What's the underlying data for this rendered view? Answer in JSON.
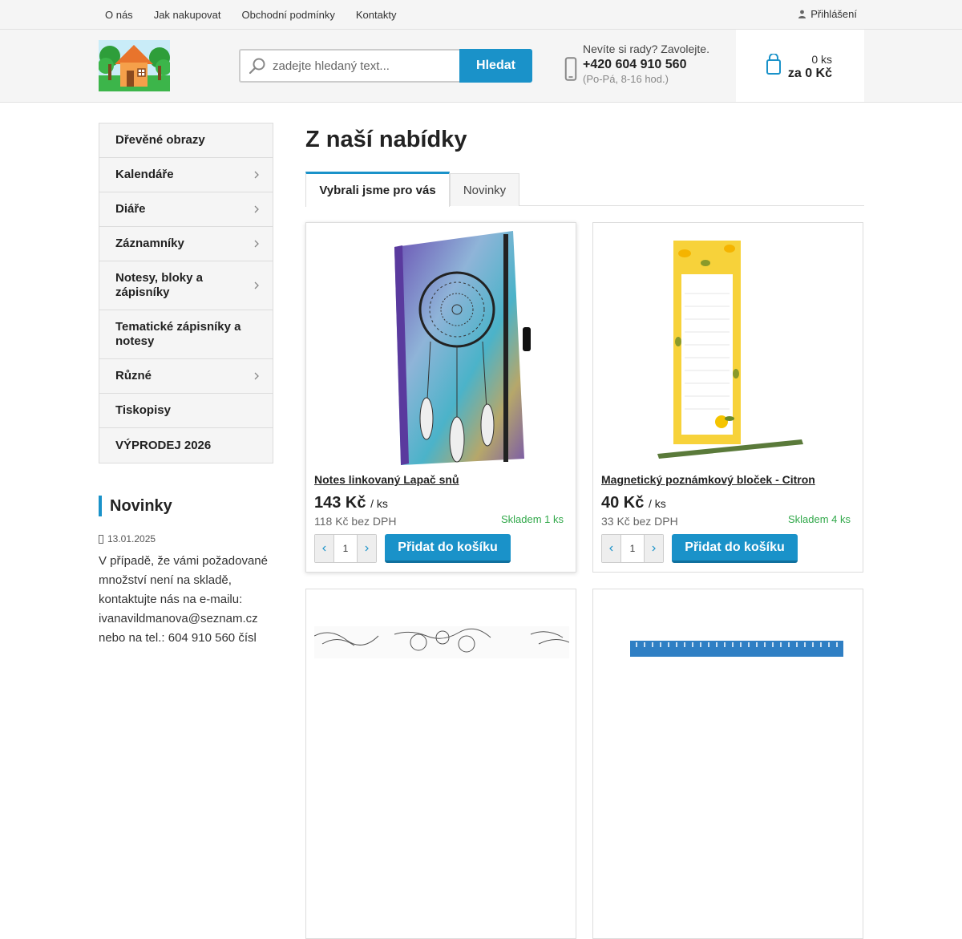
{
  "topnav": {
    "items": [
      {
        "label": "O nás"
      },
      {
        "label": "Jak nakupovat"
      },
      {
        "label": "Obchodní podmínky"
      },
      {
        "label": "Kontakty"
      }
    ],
    "login": {
      "label": "Přihlášení",
      "icon": "user-icon"
    }
  },
  "header": {
    "logo": {
      "icon": "house-logo"
    },
    "search": {
      "placeholder": "zadejte hledaný text...",
      "button": "Hledat"
    },
    "contact": {
      "question": "Nevíte si rady? Zavolejte.",
      "phone": "+420 604 910 560",
      "hours": "(Po-Pá, 8-16 hod.)"
    },
    "cart": {
      "qty": "0 ks",
      "total": "za 0 Kč"
    }
  },
  "sidebar": {
    "categories": [
      {
        "label": "Dřevěné obrazy",
        "has_sub": false
      },
      {
        "label": "Kalendáře",
        "has_sub": true
      },
      {
        "label": "Diáře",
        "has_sub": true
      },
      {
        "label": "Záznamníky",
        "has_sub": true
      },
      {
        "label": "Notesy, bloky a zápisníky",
        "has_sub": true
      },
      {
        "label": "Tematické zápisníky a notesy",
        "has_sub": false
      },
      {
        "label": "Různé",
        "has_sub": true
      },
      {
        "label": "Tiskopisy",
        "has_sub": false
      },
      {
        "label": "VÝPRODEJ 2026",
        "has_sub": false
      }
    ],
    "news": {
      "title": "Novinky",
      "date": "13.01.2025",
      "text": "V případě, že vámi požadované množství není na skladě, kontaktujte nás na e-mailu: ivanavildmanova@seznam.cz nebo na tel.: 604 910 560 čísl"
    }
  },
  "main": {
    "title": "Z naší nabídky",
    "tabs": [
      {
        "label": "Vybrali jsme pro vás"
      },
      {
        "label": "Novinky"
      }
    ],
    "products": [
      {
        "name": "Notes linkovaný Lapač snů",
        "price": "143 Kč",
        "unit": "/ ks",
        "net": "118 Kč bez DPH",
        "stock": "Skladem 1 ks",
        "qty": "1",
        "add": "Přidat do košíku"
      },
      {
        "name": "Magnetický poznámkový bloček - Citron",
        "price": "40 Kč",
        "unit": "/ ks",
        "net": "33 Kč bez DPH",
        "stock": "Skladem 4 ks",
        "qty": "1",
        "add": "Přidat do košíku"
      }
    ]
  },
  "colors": {
    "accent": "#1a92c9",
    "stock": "#31a84a",
    "panel": "#f5f5f5"
  }
}
